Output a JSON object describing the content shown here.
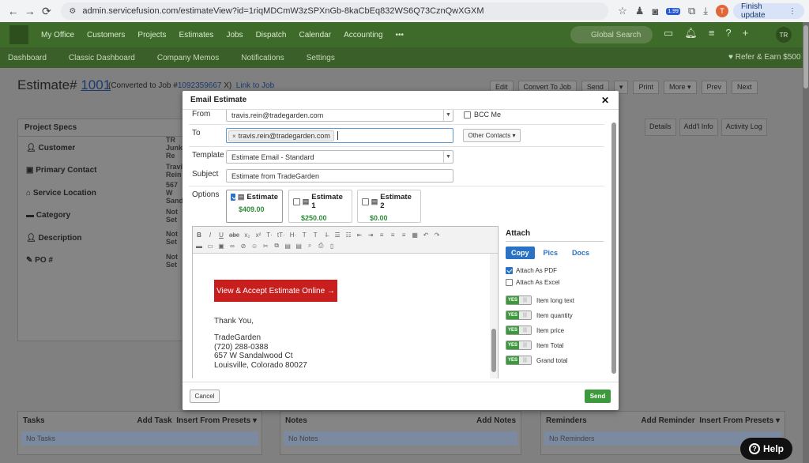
{
  "browser": {
    "url": "admin.servicefusion.com/estimateView?id=1riqMDCmW3zSPXnGb-8kaCbEq832WS6Q73CznQwXGXM",
    "badge": "1.99",
    "profile_initial": "T",
    "finish_update": "Finish update"
  },
  "nav": {
    "items": [
      "My Office",
      "Customers",
      "Projects",
      "Estimates",
      "Jobs",
      "Dispatch",
      "Calendar",
      "Accounting",
      "•••"
    ],
    "search_placeholder": "Global Search",
    "user_initials": "TR"
  },
  "subnav": {
    "items": [
      "Dashboard",
      "Classic Dashboard",
      "Company Memos",
      "Notifications",
      "Settings"
    ],
    "refer": "Refer & Earn $500"
  },
  "page": {
    "title_prefix": "Estimate#",
    "title_number": "1001",
    "converted_prefix": "(Converted to Job #",
    "converted_job": "1092359667",
    "converted_suffix": "X)",
    "link_to_job": "Link to Job",
    "toolbar": [
      "Edit",
      "Convert To Job",
      "Send",
      "▾",
      "Print",
      "More ▾",
      "Prev",
      "Next"
    ],
    "specs_title": "Project Specs",
    "specs": [
      {
        "label": "Customer",
        "value": "TR Junk Re"
      },
      {
        "label": "Primary Contact",
        "value": "Travis Rein"
      },
      {
        "label": "Service Location",
        "value": "567 W Sand"
      },
      {
        "label": "Category",
        "value": "Not Set"
      },
      {
        "label": "Description",
        "value": "Not Set"
      },
      {
        "label": "PO #",
        "value": "Not Set"
      }
    ],
    "right_tabs": [
      "Details",
      "Add'l Info",
      "Activity Log"
    ],
    "tasks": {
      "title": "Tasks",
      "add": "Add Task",
      "insert": "Insert From Presets ▾",
      "empty": "No Tasks"
    },
    "notes": {
      "title": "Notes",
      "add": "Add Notes",
      "empty": "No Notes"
    },
    "reminders": {
      "title": "Reminders",
      "add": "Add Reminder",
      "insert": "Insert From Presets ▾",
      "empty": "No Reminders"
    }
  },
  "modal": {
    "title": "Email Estimate",
    "from_label": "From",
    "from_value": "travis.rein@tradegarden.com",
    "bcc_label": "BCC Me",
    "to_label": "To",
    "to_chip": "travis.rein@tradegarden.com",
    "other_contacts": "Other Contacts ▾",
    "template_label": "Template",
    "template_value": "Estimate Email - Standard",
    "subject_label": "Subject",
    "subject_value": "Estimate  from TradeGarden",
    "options_label": "Options",
    "options": [
      {
        "name": "Estimate",
        "price": "$409.00",
        "checked": true
      },
      {
        "name": "Estimate 1",
        "price": "$250.00",
        "checked": false
      },
      {
        "name": "Estimate 2",
        "price": "$0.00",
        "checked": false
      }
    ],
    "cta": "View & Accept Estimate Online →",
    "thank_you": "Thank You,",
    "signature": [
      "TradeGarden",
      "(720) 288-0388",
      "657 W Sandalwood Ct",
      "Louisville, Colorado 80027"
    ],
    "attach": {
      "title": "Attach",
      "tabs": [
        "Copy",
        "Pics",
        "Docs"
      ],
      "pdf": "Attach As PDF",
      "excel": "Attach As Excel",
      "toggle_yes": "YES",
      "toggles": [
        "Item long text",
        "Item quantity",
        "Item price",
        "Item Total",
        "Grand total"
      ]
    },
    "cancel": "Cancel",
    "send": "Send"
  },
  "help": "Help"
}
